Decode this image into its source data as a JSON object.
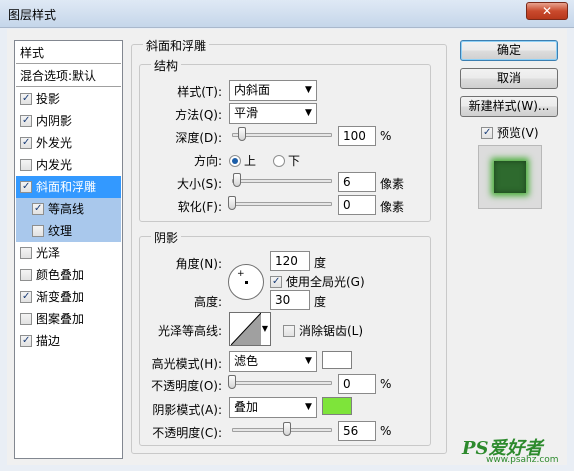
{
  "window": {
    "title": "图层样式",
    "close": "✕"
  },
  "style_list": {
    "header": "样式",
    "blend_options": "混合选项:默认",
    "items": [
      {
        "label": "投影",
        "checked": true
      },
      {
        "label": "内阴影",
        "checked": true
      },
      {
        "label": "外发光",
        "checked": true
      },
      {
        "label": "内发光",
        "checked": false
      },
      {
        "label": "斜面和浮雕",
        "checked": true,
        "selected": true
      },
      {
        "label": "等高线",
        "checked": true,
        "sub": true
      },
      {
        "label": "纹理",
        "checked": false,
        "sub": true
      },
      {
        "label": "光泽",
        "checked": false
      },
      {
        "label": "颜色叠加",
        "checked": false
      },
      {
        "label": "渐变叠加",
        "checked": true
      },
      {
        "label": "图案叠加",
        "checked": false
      },
      {
        "label": "描边",
        "checked": true
      }
    ]
  },
  "bevel": {
    "section_title": "斜面和浮雕",
    "structure": {
      "title": "结构",
      "style_label": "样式(T):",
      "style_value": "内斜面",
      "technique_label": "方法(Q):",
      "technique_value": "平滑",
      "depth_label": "深度(D):",
      "depth_value": "100",
      "depth_unit": "%",
      "direction_label": "方向:",
      "dir_up": "上",
      "dir_down": "下",
      "size_label": "大小(S):",
      "size_value": "6",
      "size_unit": "像素",
      "soften_label": "软化(F):",
      "soften_value": "0",
      "soften_unit": "像素"
    },
    "shading": {
      "title": "阴影",
      "angle_label": "角度(N):",
      "angle_value": "120",
      "angle_unit": "度",
      "global_light_label": "使用全局光(G)",
      "altitude_label": "高度:",
      "altitude_value": "30",
      "altitude_unit": "度",
      "gloss_label": "光泽等高线:",
      "antialias_label": "消除锯齿(L)",
      "highlight_label": "高光模式(H):",
      "highlight_value": "滤色",
      "highlight_color": "#ffffff",
      "hl_opacity_label": "不透明度(O):",
      "hl_opacity_value": "0",
      "hl_opacity_unit": "%",
      "shadow_label": "阴影模式(A):",
      "shadow_value": "叠加",
      "shadow_color": "#7ee43a",
      "sh_opacity_label": "不透明度(C):",
      "sh_opacity_value": "56",
      "sh_opacity_unit": "%"
    }
  },
  "buttons": {
    "ok": "确定",
    "cancel": "取消",
    "new_style": "新建样式(W)...",
    "preview": "预览(V)"
  },
  "watermark": {
    "brand": "PS爱好者",
    "url": "www.psahz.com"
  }
}
